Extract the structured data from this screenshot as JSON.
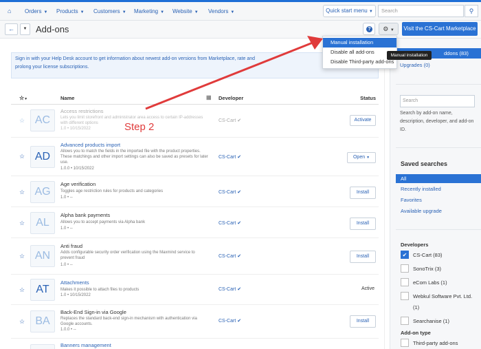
{
  "nav": [
    "Orders",
    "Products",
    "Customers",
    "Marketing",
    "Website",
    "Vendors"
  ],
  "top": {
    "quick_start": "Quick start menu",
    "search_placeholder": "Search"
  },
  "header": {
    "title": "Add-ons",
    "visit_button": "Visit the CS-Cart Marketplace"
  },
  "notice": {
    "line1": "Sign in with your Help Desk account to get information about newest add-on versions from Marketplace, rate and",
    "line2": "prolong your license subscriptions."
  },
  "table": {
    "col_name": "Name",
    "col_developer": "Developer",
    "col_status": "Status"
  },
  "rows": [
    {
      "abbr": "AC",
      "name": "Access restrictions",
      "desc": "Lets you limit storefront and administrator area access to certain IP-addresses with different options",
      "version": "1.0 • 10/15/2022",
      "developer": "CS-Cart",
      "action": "Activate"
    },
    {
      "abbr": "AD",
      "name": "Advanced products import",
      "desc": "Allows you to match the fields in the imported file with the product properties. These matchings and other import settings can also be saved as presets for later use.",
      "version": "1.0.0 • 10/15/2022",
      "developer": "CS-Cart",
      "action": "Open"
    },
    {
      "abbr": "AG",
      "name": "Age verification",
      "desc": "Toggles age restriction rules for products and categories",
      "version": "1.0 • --",
      "developer": "CS-Cart",
      "action": "Install"
    },
    {
      "abbr": "AL",
      "name": "Alpha bank payments",
      "desc": "Allows you to accept payments via Alpha bank",
      "version": "1.0 • --",
      "developer": "CS-Cart",
      "action": "Install"
    },
    {
      "abbr": "AN",
      "name": "Anti fraud",
      "desc": "Adds configurable security order verification using the Maxmind service to prevent fraud",
      "version": "1.0 • --",
      "developer": "CS-Cart",
      "action": "Install"
    },
    {
      "abbr": "AT",
      "name": "Attachments",
      "desc": "Makes it possible to attach files to products",
      "version": "1.0 • 10/15/2022",
      "developer": "CS-Cart",
      "status": "Active"
    },
    {
      "abbr": "BA",
      "name": "Back-End Sign-in via Google",
      "desc": "Replaces the standard back-end sign-in mechanism with authentication via Google accounts.",
      "version": "1.0.0 • --",
      "developer": "CS-Cart",
      "action": "Install"
    },
    {
      "abbr": "BA",
      "name": "Banners management"
    }
  ],
  "sidebar": {
    "all_addons": "ddons (83)",
    "upgrades": "Upgrades (0)",
    "search_placeholder": "Search",
    "search_help": "Search by add-on name, description, developer, and add-on ID.",
    "saved_title": "Saved searches",
    "saved": [
      "All",
      "Recently installed",
      "Favorites",
      "Available upgrade"
    ],
    "dev_title": "Developers",
    "devs": [
      "CS-Cart (83)",
      "SonoTrix (3)",
      "eCom Labs (1)",
      "Webkul Software Pvt. Ltd."
    ],
    "devs_count_3": "(1)",
    "type_title": "Add-on type",
    "type_third_party": "Third-party add-ons"
  },
  "dropdown": [
    "Manual installation",
    "Disable all add-ons",
    "Disable Third-party add-ons"
  ],
  "tooltip": "Manual installation",
  "annotation": {
    "step": "Step 2"
  },
  "colors": {
    "accent": "#2a72d4",
    "annotation": "#e03b3b"
  }
}
